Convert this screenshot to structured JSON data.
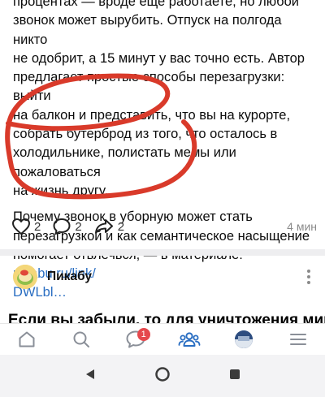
{
  "post": {
    "line1": "процентах — вроде еще работаете, но любой",
    "line2": "звонок может вырубить. Отпуск на полгода никто",
    "line3": "не одобрит, а 15 минут у вас точно есть. Автор",
    "line4": "предлагает простые способы перезагрузки: выйти",
    "line5": "на балкон и представить, что вы на курорте,",
    "line6": "собрать бутерброд из того, что осталось в",
    "line7": "холодильнике, полистать мемы или пожаловаться",
    "line8": "на жизнь другу.",
    "p2_line1": "Почему звонок в уборную может стать",
    "p2_line2": "перезагрузкой и как семантическое насыщение",
    "p2_line3": "помогает отвлечься, — в материале: ",
    "link_part1": "pikabu.ru/link/",
    "link_part2": "DWLbl…"
  },
  "actions": {
    "likes": "2",
    "comments": "2",
    "shares": "2",
    "time": "4 мин"
  },
  "author": {
    "name": "Пикабу"
  },
  "next_post": {
    "title": "Если вы забыли, то для уничтожения мира"
  },
  "tabbar": {
    "notifications_badge": "1"
  },
  "colors": {
    "link": "#2a6ec2",
    "accent": "#2a6ec2",
    "badge": "#e5484d",
    "scribble": "#d93a2a"
  }
}
